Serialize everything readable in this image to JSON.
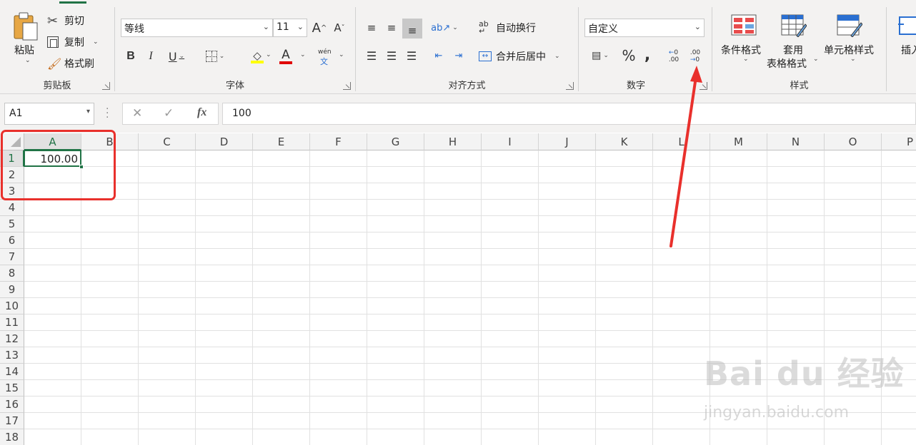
{
  "ribbon": {
    "clipboard": {
      "label": "剪贴板",
      "paste": "粘贴",
      "cut": "剪切",
      "copy": "复制",
      "format_painter": "格式刷"
    },
    "font": {
      "label": "字体",
      "font_name": "等线",
      "font_size": "11",
      "bold": "B",
      "italic": "I",
      "underline": "U",
      "increase_size": "A",
      "decrease_size": "A",
      "font_color_glyph": "A",
      "phonetic_top": "wén",
      "phonetic_bottom": "文"
    },
    "alignment": {
      "label": "对齐方式",
      "wrap_text": "自动换行",
      "merge_center": "合并后居中"
    },
    "number": {
      "label": "数字",
      "format": "自定义",
      "percent": "%",
      "comma": ","
    },
    "styles": {
      "label": "样式",
      "conditional": "条件格式",
      "table_format_1": "套用",
      "table_format_2": "表格格式",
      "cell_styles": "单元格样式"
    },
    "cells": {
      "insert": "插入"
    }
  },
  "formula_bar": {
    "name_box": "A1",
    "fx": "fx",
    "content": "100"
  },
  "sheet": {
    "columns": [
      "A",
      "B",
      "C",
      "D",
      "E",
      "F",
      "G",
      "H",
      "I",
      "J",
      "K",
      "L",
      "M",
      "N",
      "O",
      "P"
    ],
    "rows": [
      "1",
      "2",
      "3",
      "4",
      "5",
      "6",
      "7",
      "8",
      "9",
      "10",
      "11",
      "12",
      "13",
      "14",
      "15",
      "16",
      "17",
      "18"
    ],
    "cell_a1": "100.00"
  },
  "watermark": {
    "main": "Bai du 经验",
    "url": "jingyan.baidu.com"
  },
  "colors": {
    "accent": "#217346",
    "annotation": "#e9302c"
  }
}
